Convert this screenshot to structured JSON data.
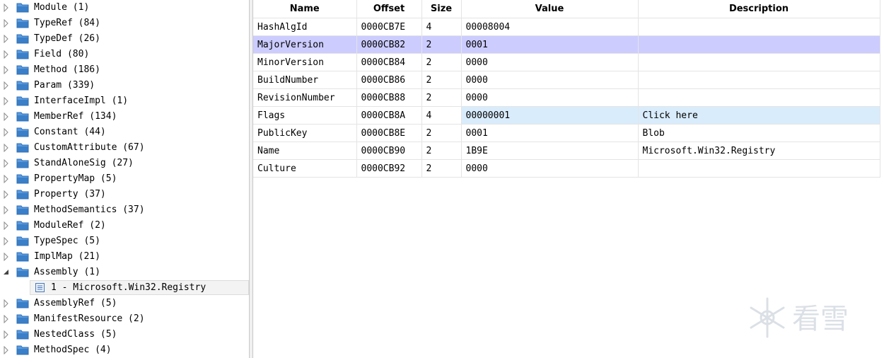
{
  "tree": {
    "items": [
      {
        "label": "Module (1)",
        "expanded": false
      },
      {
        "label": "TypeRef (84)",
        "expanded": false
      },
      {
        "label": "TypeDef (26)",
        "expanded": false
      },
      {
        "label": "Field (80)",
        "expanded": false
      },
      {
        "label": "Method (186)",
        "expanded": false
      },
      {
        "label": "Param (339)",
        "expanded": false
      },
      {
        "label": "InterfaceImpl (1)",
        "expanded": false
      },
      {
        "label": "MemberRef (134)",
        "expanded": false
      },
      {
        "label": "Constant (44)",
        "expanded": false
      },
      {
        "label": "CustomAttribute (67)",
        "expanded": false
      },
      {
        "label": "StandAloneSig (27)",
        "expanded": false
      },
      {
        "label": "PropertyMap (5)",
        "expanded": false
      },
      {
        "label": "Property (37)",
        "expanded": false
      },
      {
        "label": "MethodSemantics (37)",
        "expanded": false
      },
      {
        "label": "ModuleRef (2)",
        "expanded": false
      },
      {
        "label": "TypeSpec (5)",
        "expanded": false
      },
      {
        "label": "ImplMap (21)",
        "expanded": false
      },
      {
        "label": "Assembly (1)",
        "expanded": true
      },
      {
        "label": "1 - Microsoft.Win32.Registry",
        "child": true,
        "selected": true
      },
      {
        "label": "AssemblyRef (5)",
        "expanded": false
      },
      {
        "label": "ManifestResource (2)",
        "expanded": false
      },
      {
        "label": "NestedClass (5)",
        "expanded": false
      },
      {
        "label": "MethodSpec (4)",
        "expanded": false
      }
    ]
  },
  "grid": {
    "columns": [
      "Name",
      "Offset",
      "Size",
      "Value",
      "Description"
    ],
    "rows": [
      {
        "name": "HashAlgId",
        "offset": "0000CB7E",
        "size": "4",
        "value": "00008004",
        "desc": ""
      },
      {
        "name": "MajorVersion",
        "offset": "0000CB82",
        "size": "2",
        "value": "0001",
        "desc": "",
        "state": "selected"
      },
      {
        "name": "MinorVersion",
        "offset": "0000CB84",
        "size": "2",
        "value": "0000",
        "desc": ""
      },
      {
        "name": "BuildNumber",
        "offset": "0000CB86",
        "size": "2",
        "value": "0000",
        "desc": ""
      },
      {
        "name": "RevisionNumber",
        "offset": "0000CB88",
        "size": "2",
        "value": "0000",
        "desc": ""
      },
      {
        "name": "Flags",
        "offset": "0000CB8A",
        "size": "4",
        "value": "00000001",
        "desc": "Click here",
        "state": "highlight"
      },
      {
        "name": "PublicKey",
        "offset": "0000CB8E",
        "size": "2",
        "value": "0001",
        "desc": "Blob"
      },
      {
        "name": "Name",
        "offset": "0000CB90",
        "size": "2",
        "value": "1B9E",
        "desc": "Microsoft.Win32.Registry"
      },
      {
        "name": "Culture",
        "offset": "0000CB92",
        "size": "2",
        "value": "0000",
        "desc": ""
      }
    ]
  },
  "icons": {
    "folder": "folder-icon",
    "arrow_collapsed": "tree-collapsed-arrow-icon",
    "arrow_expanded": "tree-expanded-arrow-icon",
    "row": "table-row-icon",
    "watermark": "kanxue-snowflake-logo"
  },
  "watermark": {
    "text": "看雪"
  },
  "colors": {
    "selected_row": "#ccccff",
    "highlight_cell": "#d9ecfb",
    "folder_blue": "#3a7fc8"
  }
}
